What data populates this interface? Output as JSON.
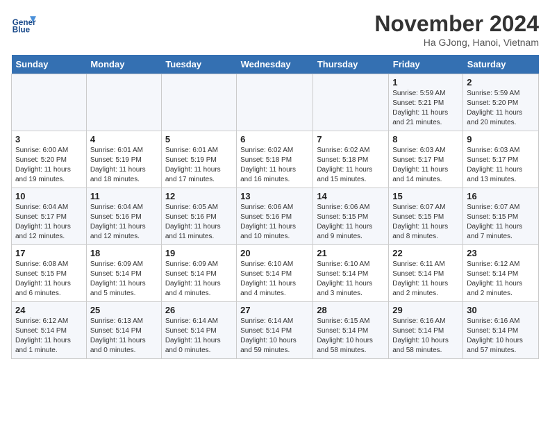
{
  "header": {
    "logo_line1": "General",
    "logo_line2": "Blue",
    "month": "November 2024",
    "location": "Ha GJong, Hanoi, Vietnam"
  },
  "weekdays": [
    "Sunday",
    "Monday",
    "Tuesday",
    "Wednesday",
    "Thursday",
    "Friday",
    "Saturday"
  ],
  "weeks": [
    [
      {
        "day": "",
        "info": ""
      },
      {
        "day": "",
        "info": ""
      },
      {
        "day": "",
        "info": ""
      },
      {
        "day": "",
        "info": ""
      },
      {
        "day": "",
        "info": ""
      },
      {
        "day": "1",
        "info": "Sunrise: 5:59 AM\nSunset: 5:21 PM\nDaylight: 11 hours and 21 minutes."
      },
      {
        "day": "2",
        "info": "Sunrise: 5:59 AM\nSunset: 5:20 PM\nDaylight: 11 hours and 20 minutes."
      }
    ],
    [
      {
        "day": "3",
        "info": "Sunrise: 6:00 AM\nSunset: 5:20 PM\nDaylight: 11 hours and 19 minutes."
      },
      {
        "day": "4",
        "info": "Sunrise: 6:01 AM\nSunset: 5:19 PM\nDaylight: 11 hours and 18 minutes."
      },
      {
        "day": "5",
        "info": "Sunrise: 6:01 AM\nSunset: 5:19 PM\nDaylight: 11 hours and 17 minutes."
      },
      {
        "day": "6",
        "info": "Sunrise: 6:02 AM\nSunset: 5:18 PM\nDaylight: 11 hours and 16 minutes."
      },
      {
        "day": "7",
        "info": "Sunrise: 6:02 AM\nSunset: 5:18 PM\nDaylight: 11 hours and 15 minutes."
      },
      {
        "day": "8",
        "info": "Sunrise: 6:03 AM\nSunset: 5:17 PM\nDaylight: 11 hours and 14 minutes."
      },
      {
        "day": "9",
        "info": "Sunrise: 6:03 AM\nSunset: 5:17 PM\nDaylight: 11 hours and 13 minutes."
      }
    ],
    [
      {
        "day": "10",
        "info": "Sunrise: 6:04 AM\nSunset: 5:17 PM\nDaylight: 11 hours and 12 minutes."
      },
      {
        "day": "11",
        "info": "Sunrise: 6:04 AM\nSunset: 5:16 PM\nDaylight: 11 hours and 12 minutes."
      },
      {
        "day": "12",
        "info": "Sunrise: 6:05 AM\nSunset: 5:16 PM\nDaylight: 11 hours and 11 minutes."
      },
      {
        "day": "13",
        "info": "Sunrise: 6:06 AM\nSunset: 5:16 PM\nDaylight: 11 hours and 10 minutes."
      },
      {
        "day": "14",
        "info": "Sunrise: 6:06 AM\nSunset: 5:15 PM\nDaylight: 11 hours and 9 minutes."
      },
      {
        "day": "15",
        "info": "Sunrise: 6:07 AM\nSunset: 5:15 PM\nDaylight: 11 hours and 8 minutes."
      },
      {
        "day": "16",
        "info": "Sunrise: 6:07 AM\nSunset: 5:15 PM\nDaylight: 11 hours and 7 minutes."
      }
    ],
    [
      {
        "day": "17",
        "info": "Sunrise: 6:08 AM\nSunset: 5:15 PM\nDaylight: 11 hours and 6 minutes."
      },
      {
        "day": "18",
        "info": "Sunrise: 6:09 AM\nSunset: 5:14 PM\nDaylight: 11 hours and 5 minutes."
      },
      {
        "day": "19",
        "info": "Sunrise: 6:09 AM\nSunset: 5:14 PM\nDaylight: 11 hours and 4 minutes."
      },
      {
        "day": "20",
        "info": "Sunrise: 6:10 AM\nSunset: 5:14 PM\nDaylight: 11 hours and 4 minutes."
      },
      {
        "day": "21",
        "info": "Sunrise: 6:10 AM\nSunset: 5:14 PM\nDaylight: 11 hours and 3 minutes."
      },
      {
        "day": "22",
        "info": "Sunrise: 6:11 AM\nSunset: 5:14 PM\nDaylight: 11 hours and 2 minutes."
      },
      {
        "day": "23",
        "info": "Sunrise: 6:12 AM\nSunset: 5:14 PM\nDaylight: 11 hours and 2 minutes."
      }
    ],
    [
      {
        "day": "24",
        "info": "Sunrise: 6:12 AM\nSunset: 5:14 PM\nDaylight: 11 hours and 1 minute."
      },
      {
        "day": "25",
        "info": "Sunrise: 6:13 AM\nSunset: 5:14 PM\nDaylight: 11 hours and 0 minutes."
      },
      {
        "day": "26",
        "info": "Sunrise: 6:14 AM\nSunset: 5:14 PM\nDaylight: 11 hours and 0 minutes."
      },
      {
        "day": "27",
        "info": "Sunrise: 6:14 AM\nSunset: 5:14 PM\nDaylight: 10 hours and 59 minutes."
      },
      {
        "day": "28",
        "info": "Sunrise: 6:15 AM\nSunset: 5:14 PM\nDaylight: 10 hours and 58 minutes."
      },
      {
        "day": "29",
        "info": "Sunrise: 6:16 AM\nSunset: 5:14 PM\nDaylight: 10 hours and 58 minutes."
      },
      {
        "day": "30",
        "info": "Sunrise: 6:16 AM\nSunset: 5:14 PM\nDaylight: 10 hours and 57 minutes."
      }
    ]
  ]
}
